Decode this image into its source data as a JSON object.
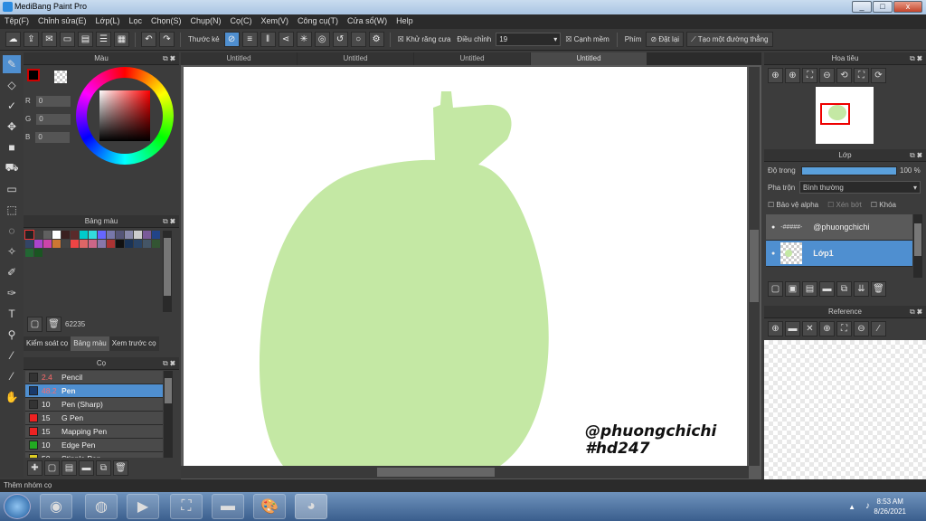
{
  "window": {
    "title": "MediBang Paint Pro",
    "min": "_",
    "max": "□",
    "close": "x"
  },
  "menu": [
    "Tệp(F)",
    "Chỉnh sửa(E)",
    "Lớp(L)",
    "Lọc",
    "Chọn(S)",
    "Chụp(N)",
    "Cọ(C)",
    "Xem(V)",
    "Công cụ(T)",
    "Cửa sổ(W)",
    "Help"
  ],
  "toolbar": {
    "ruler_label": "Thước kẻ",
    "antialias_label": "Khử răng cưa",
    "correction_label": "Điều chỉnh",
    "correction_value": "19",
    "edge_label": "Cạnh mềm",
    "key_label": "Phím",
    "reset_label": "Đặt lại",
    "straight_label": "Tạo một đường thẳng"
  },
  "color_panel": {
    "title": "Màu",
    "r_label": "R",
    "g_label": "G",
    "b_label": "B",
    "r": "0",
    "g": "0",
    "b": "0",
    "primary": "#cc0000",
    "secondary": "#ffffff"
  },
  "palette_panel": {
    "title": "Bảng màu",
    "count": "62235",
    "tabs": [
      "Kiểm soát cọ",
      "Bảng màu",
      "Xem trước cọ"
    ],
    "swatches": [
      "#222222",
      "#404040",
      "#606060",
      "#ffffff",
      "#3a2020",
      "#5a2a2a",
      "#00cccc",
      "#33dddd",
      "#6666ff",
      "#7777aa",
      "#555577",
      "#8888aa",
      "#cccccc",
      "#7a5a9a",
      "#224488",
      "#334466",
      "#aa44cc",
      "#cc44aa",
      "#cc7733",
      "#444444",
      "#ee4444",
      "#dd6666",
      "#cc6688",
      "#8877aa",
      "#aa3333",
      "#111111",
      "#1a3355",
      "#2a4466",
      "#445566",
      "#335533",
      "#226633",
      "#1a5522"
    ]
  },
  "brush_panel": {
    "title": "Cọ",
    "items": [
      {
        "size": "2.4",
        "name": "Pencil",
        "color": "#333333",
        "sel": false,
        "red": true
      },
      {
        "size": "48.2",
        "name": "Pen",
        "color": "#1a3a6a",
        "sel": true,
        "red": true
      },
      {
        "size": "10",
        "name": "Pen (Sharp)",
        "color": "#333333",
        "sel": false,
        "red": false
      },
      {
        "size": "15",
        "name": "G Pen",
        "color": "#ee2222",
        "sel": false,
        "red": false
      },
      {
        "size": "15",
        "name": "Mapping Pen",
        "color": "#ee2222",
        "sel": false,
        "red": false
      },
      {
        "size": "10",
        "name": "Edge Pen",
        "color": "#22aa22",
        "sel": false,
        "red": false
      },
      {
        "size": "50",
        "name": "Stipple Pen",
        "color": "#ddcc22",
        "sel": false,
        "red": false
      }
    ]
  },
  "tabs": [
    "Untitled",
    "Untitled",
    "Untitled",
    "Untitled"
  ],
  "canvas": {
    "watermark1": "@phuongchichi",
    "watermark2": "#hd247",
    "shape_color": "#c4e8a4"
  },
  "navigator": {
    "title": "Hoa tiêu"
  },
  "layer_panel": {
    "title": "Lớp",
    "opacity_label": "Độ trong",
    "opacity_value": "100 %",
    "blend_label": "Pha trộn",
    "blend_value": "Bình thường",
    "protect_alpha": "Bảo vệ alpha",
    "clipping": "Xén bớt",
    "lock": "Khóa",
    "layers": [
      {
        "name": "@phuongchichi",
        "thumb": "-#####-",
        "sel": false
      },
      {
        "name": "Lớp1",
        "sel": true
      }
    ]
  },
  "reference": {
    "title": "Reference"
  },
  "status": "Thêm nhóm cọ",
  "clock": {
    "time": "8:53 AM",
    "date": "8/26/2021"
  }
}
